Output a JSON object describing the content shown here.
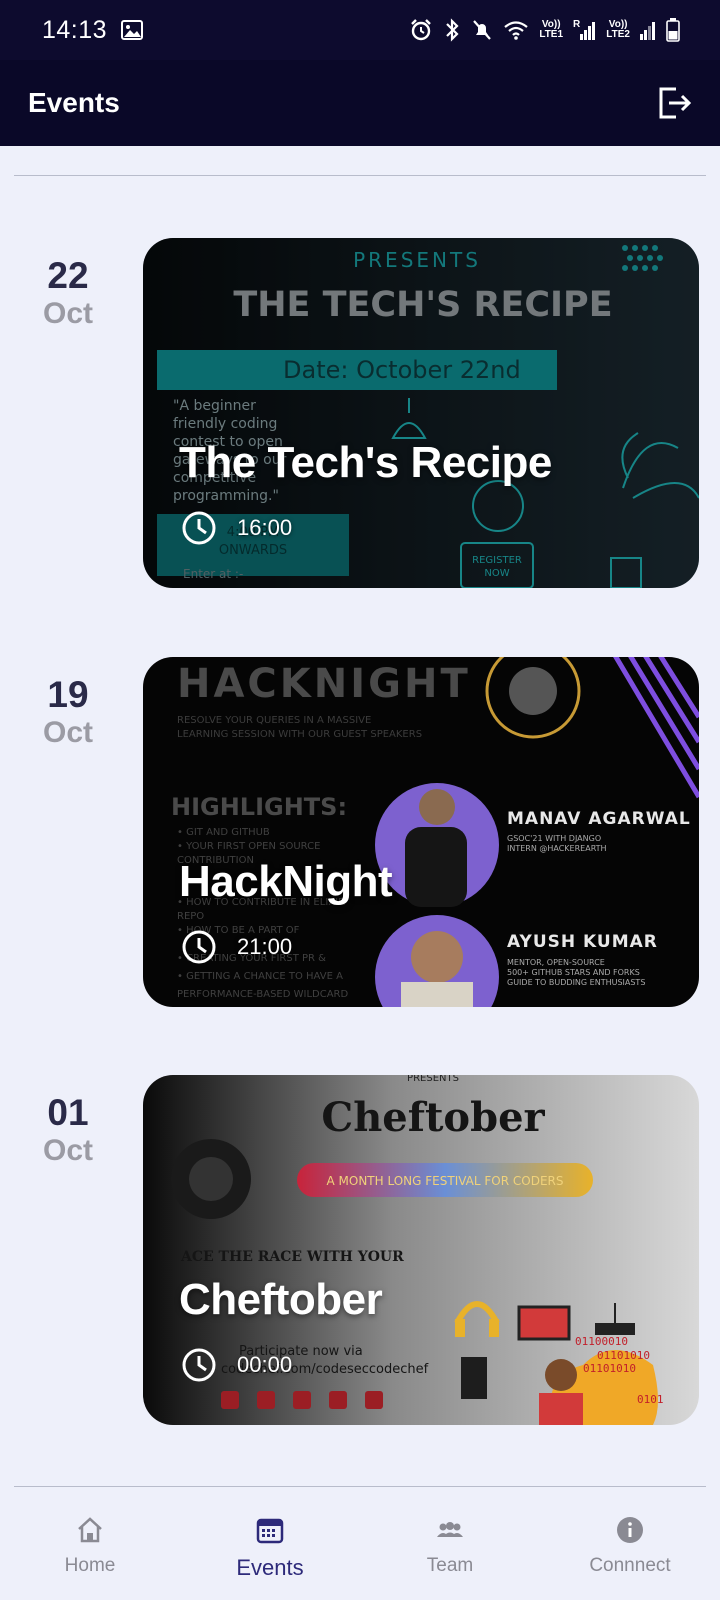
{
  "status_bar": {
    "time": "14:13",
    "sim1_label_top": "Vo))",
    "sim1_label_bottom": "LTE1",
    "sim1_r": "R",
    "sim2_label_top": "Vo))",
    "sim2_label_bottom": "LTE2"
  },
  "app_bar": {
    "title": "Events"
  },
  "events": [
    {
      "day": "22",
      "month": "Oct",
      "title": "The Tech's Recipe",
      "time": "16:00",
      "poster": {
        "presents": "PRESENTS",
        "headline": "THE TECH'S RECIPE",
        "date_banner": "Date: October 22nd",
        "quote_lines": [
          "\"A beginner",
          "friendly coding",
          "contest to open",
          "gateways to our",
          "competitive",
          "programming.\""
        ],
        "time_block_1": "4:00 PM",
        "time_block_2": "ONWARDS",
        "register_1": "REGISTER",
        "register_2": "NOW",
        "enter_at": "Enter at :-"
      }
    },
    {
      "day": "19",
      "month": "Oct",
      "title": "HackNight",
      "time": "21:00",
      "poster": {
        "headline": "HACKNIGHT",
        "sub_1": "RESOLVE YOUR QUERIES IN A MASSIVE",
        "sub_2": "LEARNING SESSION WITH OUR GUEST SPEAKERS",
        "highlights": "HIGHLIGHTS:",
        "bullets": [
          "• GIT AND GITHUB",
          "• YOUR FIRST OPEN SOURCE",
          "  CONTRIBUTION",
          "• HOW TO CONTRIBUTE IN ELIXIR",
          "  REPO",
          "• HOW TO BE A PART OF",
          "• CREATING YOUR FIRST PR &",
          "• GETTING A CHANCE TO HAVE A",
          "  PERFORMANCE-BASED WILDCARD"
        ],
        "speaker_1_name": "MANAV AGARWAL",
        "speaker_1_info_1": "GSOC'21 WITH DJANGO",
        "speaker_1_info_2": "INTERN @HACKEREARTH",
        "speaker_2_name": "AYUSH KUMAR",
        "speaker_2_info_1": "MENTOR, OPEN-SOURCE",
        "speaker_2_info_2": "500+ GITHUB STARS AND FORKS",
        "speaker_2_info_3": "GUIDE TO BUDDING ENTHUSIASTS"
      }
    },
    {
      "day": "01",
      "month": "Oct",
      "title": "Cheftober",
      "time": "00:00",
      "poster": {
        "presents": "PRESENTS",
        "headline": "Cheftober",
        "pill": "A MONTH LONG FESTIVAL FOR CODERS",
        "tagline": "ACE THE RACE WITH YOUR",
        "participate": "Participate now via",
        "handle": "codechef.com/codeseccodechef",
        "binary_1": "01100010",
        "binary_2": "01101010",
        "binary_3": "01101010",
        "binary_4": "0101"
      }
    }
  ],
  "bottom_nav": [
    {
      "label": "Home",
      "icon": "home-icon",
      "active": false
    },
    {
      "label": "Events",
      "icon": "calendar-icon",
      "active": true
    },
    {
      "label": "Team",
      "icon": "team-icon",
      "active": false
    },
    {
      "label": "Connnect",
      "icon": "info-icon",
      "active": false
    }
  ],
  "colors": {
    "status_bar": "#0d0b2e",
    "app_bar": "#0a0828",
    "background": "#eef0fa",
    "active_nav": "#2d2a7a",
    "inactive_nav": "#8a8a93"
  }
}
